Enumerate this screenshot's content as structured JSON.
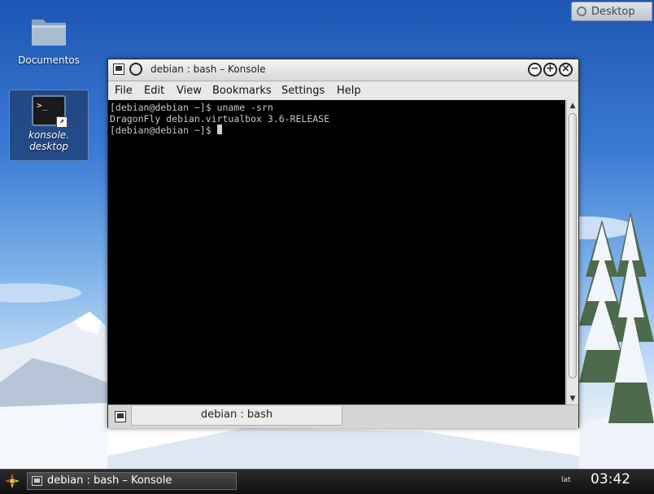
{
  "desktop": {
    "icons": [
      {
        "label": "Documentos",
        "icon": "folder-icon"
      },
      {
        "label": "konsole.\ndesktop",
        "label_line1": "konsole.",
        "label_line2": "desktop",
        "icon": "terminal-icon",
        "selected": true
      }
    ],
    "desktop_tab_label": "Desktop"
  },
  "window": {
    "title": "debian : bash – Konsole",
    "controls": [
      "minimize",
      "maximize",
      "close"
    ],
    "menu": [
      "File",
      "Edit",
      "View",
      "Bookmarks",
      "Settings",
      "Help"
    ],
    "terminal": {
      "lines": [
        "[debian@debian ~]$ uname -srn",
        "DragonFly debian.virtualbox 3.6-RELEASE",
        "[debian@debian ~]$ "
      ]
    },
    "session_tab_label": "debian : bash"
  },
  "taskbar": {
    "task_label": "debian : bash – Konsole",
    "keyboard_layout": "lat",
    "clock": "03:42"
  },
  "colors": {
    "terminal_bg": "#000000",
    "terminal_fg": "#c8c8c8",
    "taskbar_bg": "#1a1a1a"
  }
}
